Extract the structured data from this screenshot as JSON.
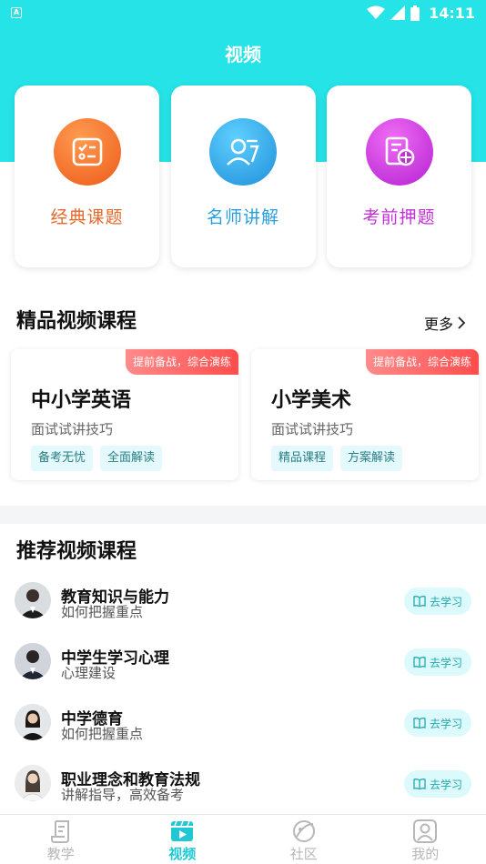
{
  "status": {
    "app_icon_letter": "A",
    "time": "14:11"
  },
  "nav": {
    "title": "视频"
  },
  "features": [
    {
      "label": "经典课题",
      "icon": "checklist-icon",
      "color": "#e5682c"
    },
    {
      "label": "名师讲解",
      "icon": "teacher-icon",
      "color": "#2a9fe0"
    },
    {
      "label": "考前押题",
      "icon": "target-doc-icon",
      "color": "#c230d6"
    }
  ],
  "premium": {
    "title": "精品视频课程",
    "more": "更多",
    "courses": [
      {
        "badge": "提前备战，综合演练",
        "title": "中小学英语",
        "subtitle": "面试试讲技巧",
        "tags": [
          "备考无忧",
          "全面解读"
        ]
      },
      {
        "badge": "提前备战，综合演练",
        "title": "小学美术",
        "subtitle": "面试试讲技巧",
        "tags": [
          "精品课程",
          "方案解读"
        ]
      }
    ]
  },
  "recommended": {
    "title": "推荐视频课程",
    "button_label": "去学习",
    "items": [
      {
        "title": "教育知识与能力",
        "subtitle": "如何把握重点"
      },
      {
        "title": "中学生学习心理",
        "subtitle": "心理建设"
      },
      {
        "title": "中学德育",
        "subtitle": "如何把握重点"
      },
      {
        "title": "职业理念和教育法规",
        "subtitle": "讲解指导，高效备考"
      }
    ]
  },
  "tabs": [
    {
      "label": "教学",
      "icon": "book-icon",
      "active": false
    },
    {
      "label": "视频",
      "icon": "video-icon",
      "active": true
    },
    {
      "label": "社区",
      "icon": "community-icon",
      "active": false
    },
    {
      "label": "我的",
      "icon": "profile-icon",
      "active": false
    }
  ],
  "colors": {
    "header": "#25e3e6",
    "active_tab": "#1fc8d2",
    "badge": "#ff4d4d"
  }
}
